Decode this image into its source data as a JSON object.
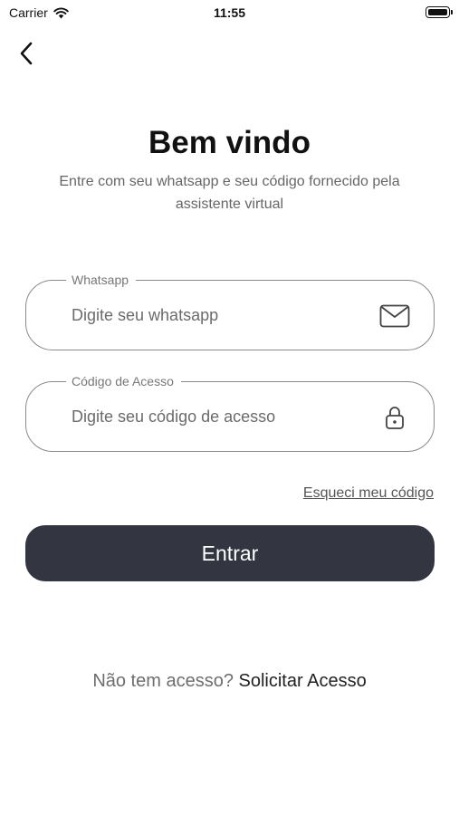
{
  "status_bar": {
    "carrier": "Carrier",
    "time": "11:55"
  },
  "header": {
    "back_icon": "chevron-left-icon"
  },
  "welcome": {
    "title": "Bem vindo",
    "subtitle": "Entre com seu whatsapp e seu código fornecido pela assistente virtual"
  },
  "whatsapp_field": {
    "label": "Whatsapp",
    "placeholder": "Digite seu whatsapp",
    "icon": "envelope-icon"
  },
  "code_field": {
    "label": "Código de Acesso",
    "placeholder": "Digite seu código de acesso",
    "icon": "lock-icon"
  },
  "forgot_link": "Esqueci meu código",
  "submit_button": "Entrar",
  "footer": {
    "question": "Não tem acesso?",
    "request_link": "Solicitar Acesso"
  },
  "colors": {
    "button_background": "#333641",
    "button_text": "#ffffff",
    "field_border": "#8a8a8a"
  }
}
